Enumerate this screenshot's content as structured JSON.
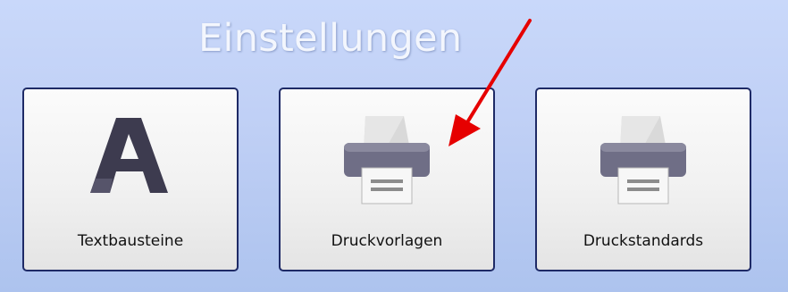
{
  "page": {
    "title": "Einstellungen"
  },
  "tiles": [
    {
      "label": "Textbausteine",
      "icon": "letter-a-icon"
    },
    {
      "label": "Druckvorlagen",
      "icon": "printer-icon"
    },
    {
      "label": "Druckstandards",
      "icon": "printer-icon"
    }
  ],
  "colors": {
    "background": "#bfcff5",
    "tile_border": "#1e2a66",
    "icon_dark": "#3d3b4f",
    "arrow": "#e60000"
  }
}
